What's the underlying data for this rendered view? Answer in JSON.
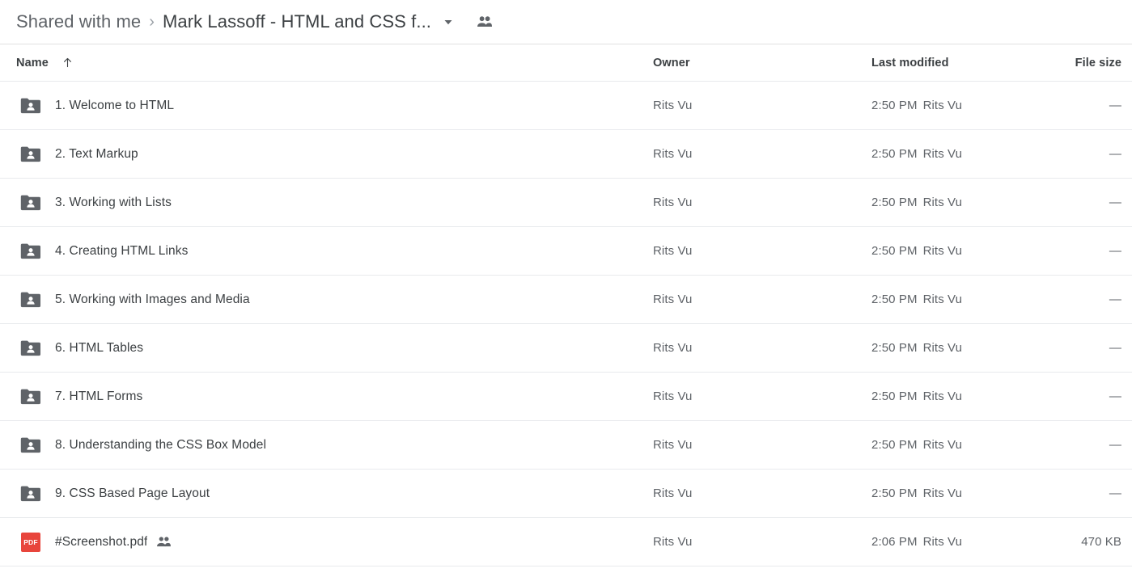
{
  "breadcrumb": {
    "parent": "Shared with me",
    "separator": "›",
    "current": "Mark Lassoff - HTML and CSS f...",
    "caret_icon": "chevron-down-icon",
    "people_icon": "people-shared-icon"
  },
  "table": {
    "headers": {
      "name": "Name",
      "sort_icon": "arrow-up-icon",
      "owner": "Owner",
      "modified": "Last modified",
      "size": "File size"
    },
    "rows": [
      {
        "icon": "shared-folder-icon",
        "name": "1. Welcome to HTML",
        "shared": false,
        "owner": "Rits Vu",
        "modified_time": "2:50 PM",
        "modified_by": "Rits Vu",
        "size": "—"
      },
      {
        "icon": "shared-folder-icon",
        "name": "2. Text Markup",
        "shared": false,
        "owner": "Rits Vu",
        "modified_time": "2:50 PM",
        "modified_by": "Rits Vu",
        "size": "—"
      },
      {
        "icon": "shared-folder-icon",
        "name": "3. Working with Lists",
        "shared": false,
        "owner": "Rits Vu",
        "modified_time": "2:50 PM",
        "modified_by": "Rits Vu",
        "size": "—"
      },
      {
        "icon": "shared-folder-icon",
        "name": "4. Creating HTML Links",
        "shared": false,
        "owner": "Rits Vu",
        "modified_time": "2:50 PM",
        "modified_by": "Rits Vu",
        "size": "—"
      },
      {
        "icon": "shared-folder-icon",
        "name": "5. Working with Images and Media",
        "shared": false,
        "owner": "Rits Vu",
        "modified_time": "2:50 PM",
        "modified_by": "Rits Vu",
        "size": "—"
      },
      {
        "icon": "shared-folder-icon",
        "name": "6. HTML Tables",
        "shared": false,
        "owner": "Rits Vu",
        "modified_time": "2:50 PM",
        "modified_by": "Rits Vu",
        "size": "—"
      },
      {
        "icon": "shared-folder-icon",
        "name": "7. HTML Forms",
        "shared": false,
        "owner": "Rits Vu",
        "modified_time": "2:50 PM",
        "modified_by": "Rits Vu",
        "size": "—"
      },
      {
        "icon": "shared-folder-icon",
        "name": "8. Understanding the CSS Box Model",
        "shared": false,
        "owner": "Rits Vu",
        "modified_time": "2:50 PM",
        "modified_by": "Rits Vu",
        "size": "—"
      },
      {
        "icon": "shared-folder-icon",
        "name": "9. CSS Based Page Layout",
        "shared": false,
        "owner": "Rits Vu",
        "modified_time": "2:50 PM",
        "modified_by": "Rits Vu",
        "size": "—"
      },
      {
        "icon": "pdf-file-icon",
        "icon_label": "PDF",
        "name": "#Screenshot.pdf",
        "shared": true,
        "owner": "Rits Vu",
        "modified_time": "2:06 PM",
        "modified_by": "Rits Vu",
        "size": "470 KB"
      }
    ]
  },
  "colors": {
    "folder_icon": "#5f6368",
    "pdf_icon": "#e8453c",
    "primary_text": "#3c4043",
    "secondary_text": "#5f6368",
    "divider": "#e8eaed"
  }
}
